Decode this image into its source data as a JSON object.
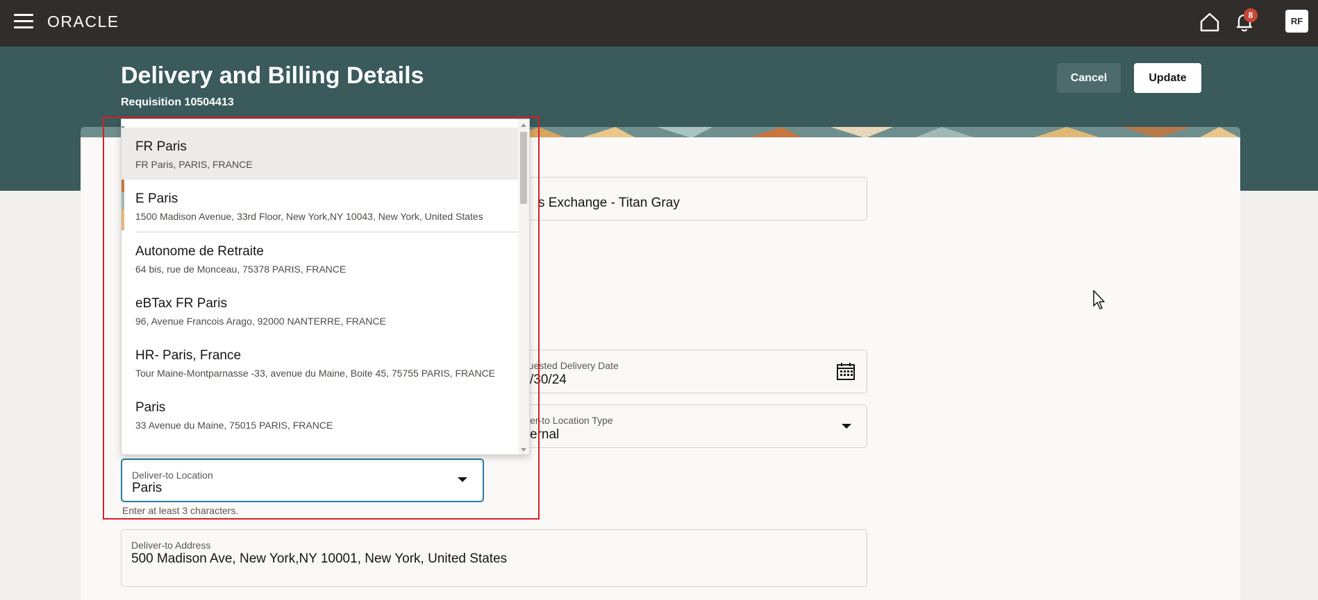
{
  "topbar": {
    "logo": "ORACLE",
    "notification_count": "8",
    "avatar_initials": "RF"
  },
  "header": {
    "title": "Delivery and Billing Details",
    "subtitle": "Requisition 10504413",
    "cancel_label": "Cancel",
    "update_label": "Update"
  },
  "form": {
    "top_field_value": "s Exchange - Titan Gray",
    "date_label": "quested Delivery Date",
    "date_value": "/30/24",
    "type_label": "iver-to Location Type",
    "type_value": "ernal",
    "location_label": "Deliver-to Location",
    "location_value": "Paris",
    "location_helper": "Enter at least 3 characters.",
    "address_label": "Deliver-to Address",
    "address_value": "500 Madison Ave, New York,NY 10001, New York, United States"
  },
  "dropdown": {
    "items": [
      {
        "title": "FR Paris",
        "subtitle": "FR Paris, PARIS, FRANCE"
      },
      {
        "title": "E Paris",
        "subtitle": "1500 Madison Avenue, 33rd Floor, New York,NY 10043, New York, United States"
      },
      {
        "title": "Autonome de Retraite",
        "subtitle": "64 bis, rue de Monceau, 75378 PARIS, FRANCE"
      },
      {
        "title": "eBTax FR Paris",
        "subtitle": "96, Avenue Francois Arago, 92000 NANTERRE, FRANCE"
      },
      {
        "title": "HR- Paris, France",
        "subtitle": "Tour Maine-Montparnasse -33, avenue du Maine, Boite 45, 75755 PARIS, FRANCE"
      },
      {
        "title": "Paris",
        "subtitle": "33 Avenue du Maine, 75015 PARIS, FRANCE"
      }
    ]
  },
  "colors": {
    "topbar": "#312d2a",
    "header_band": "#3a5a5c",
    "highlight_frame": "#d41f26",
    "focus_border": "#227e9e",
    "badge": "#c74634"
  }
}
